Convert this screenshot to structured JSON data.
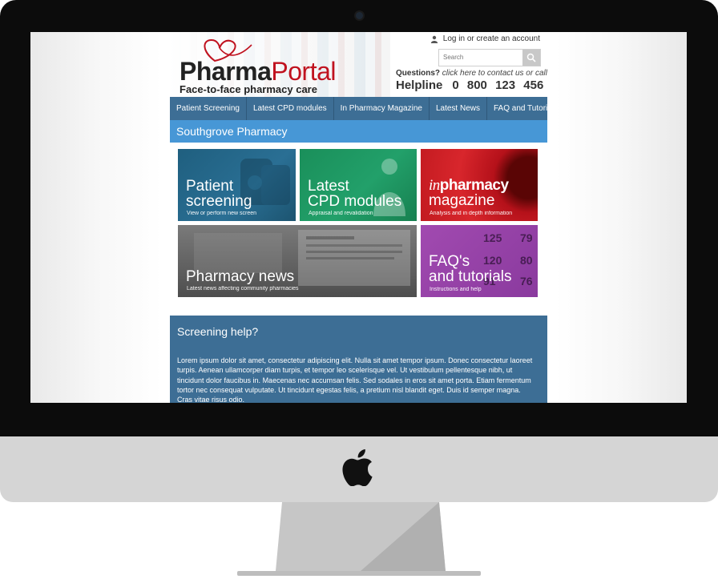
{
  "site": {
    "logo": {
      "word1": "Pharma",
      "word2": "Portal",
      "tagline": "Face-to-face pharmacy care"
    },
    "login_label": "Log in or create an account",
    "search": {
      "placeholder": "Search"
    },
    "contact": {
      "question": "Questions?",
      "prompt": "click here to contact us or call",
      "helpline_label": "Helpline",
      "helpline_number": "0 800 123 456"
    }
  },
  "nav": {
    "items": [
      {
        "label": "Patient Screening"
      },
      {
        "label": "Latest CPD modules"
      },
      {
        "label": "In Pharmacy Magazine"
      },
      {
        "label": "Latest News"
      },
      {
        "label": "FAQ and Tutorials"
      }
    ]
  },
  "location": {
    "title": "Southgrove Pharmacy"
  },
  "tiles": [
    {
      "line1": "Patient",
      "line2": "screening",
      "sub": "View or perform new screen"
    },
    {
      "line1": "Latest",
      "line2": "CPD modules",
      "sub": "Appraisal and revalidation"
    },
    {
      "prefix": "in",
      "brand": "pharmacy",
      "line2": "magazine",
      "sub": "Analysis and in depth information"
    },
    {
      "line1": "Pharmacy news",
      "sub": "Latest news affecting community pharmacies"
    },
    {
      "line1": "FAQ's",
      "line2": "and tutorials",
      "sub": "Instructions and help"
    }
  ],
  "monitor_values": [
    "125",
    "79",
    "120",
    "80",
    "91",
    "76"
  ],
  "help": {
    "title": "Screening help?",
    "body": "Lorem ipsum dolor sit amet, consectetur adipiscing elit. Nulla sit amet tempor ipsum. Donec consectetur laoreet turpis. Aenean ullamcorper diam turpis, et tempor leo scelerisque vel. Ut vestibulum pellentesque nibh, ut tincidunt dolor faucibus in. Maecenas nec accumsan felis. Sed sodales in eros sit amet porta. Etiam fermentum tortor nec consequat vulputate. Ut tincidunt egestas felis, a pretium nisl blandit eget. Duis id semper magna. Cras vitae risus odio."
  },
  "colors": {
    "nav": "#3d6e95",
    "location_bar": "#4797d6",
    "brand_red": "#c0121f"
  }
}
